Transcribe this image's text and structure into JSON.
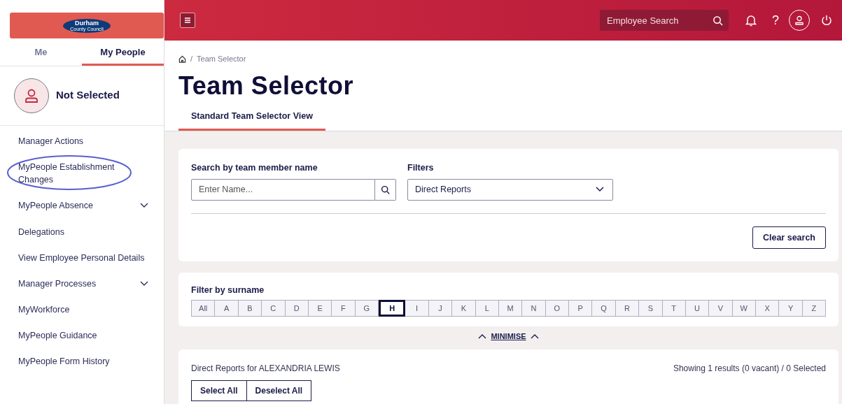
{
  "logo": {
    "name": "Durham",
    "subtitle": "County Council"
  },
  "sidebar_tabs": [
    {
      "label": "Me",
      "selected": false
    },
    {
      "label": "My People",
      "selected": true
    }
  ],
  "profile": {
    "name": "Not Selected"
  },
  "menu": [
    {
      "label": "Manager Actions",
      "expandable": false,
      "circled": false
    },
    {
      "label": "MyPeople Establishment Changes",
      "expandable": false,
      "circled": true
    },
    {
      "label": "MyPeople Absence",
      "expandable": true,
      "circled": false
    },
    {
      "label": "Delegations",
      "expandable": false,
      "circled": false
    },
    {
      "label": "View Employee Personal Details",
      "expandable": false,
      "circled": false
    },
    {
      "label": "Manager Processes",
      "expandable": true,
      "circled": false
    },
    {
      "label": "MyWorkforce",
      "expandable": false,
      "circled": false
    },
    {
      "label": "MyPeople Guidance",
      "expandable": false,
      "circled": false
    },
    {
      "label": "MyPeople Form History",
      "expandable": false,
      "circled": false
    }
  ],
  "topbar": {
    "search_placeholder": "Employee Search",
    "help": "?"
  },
  "breadcrumb": [
    {
      "separator": "/",
      "label": "Team Selector"
    }
  ],
  "page_title": "Team Selector",
  "view_tabs": [
    {
      "label": "Standard Team Selector View",
      "selected": true
    }
  ],
  "search": {
    "label": "Search by team member name",
    "placeholder": "Enter Name..."
  },
  "filters": {
    "label": "Filters",
    "value": "Direct Reports"
  },
  "clear_button": "Clear search",
  "surname_filter": {
    "label": "Filter by surname",
    "letters": [
      {
        "label": "All",
        "selected": false
      },
      {
        "label": "A",
        "selected": false
      },
      {
        "label": "B",
        "selected": false
      },
      {
        "label": "C",
        "selected": false
      },
      {
        "label": "D",
        "selected": false
      },
      {
        "label": "E",
        "selected": false
      },
      {
        "label": "F",
        "selected": false
      },
      {
        "label": "G",
        "selected": false
      },
      {
        "label": "H",
        "selected": true
      },
      {
        "label": "I",
        "selected": false
      },
      {
        "label": "J",
        "selected": false
      },
      {
        "label": "K",
        "selected": false
      },
      {
        "label": "L",
        "selected": false
      },
      {
        "label": "M",
        "selected": false
      },
      {
        "label": "N",
        "selected": false
      },
      {
        "label": "O",
        "selected": false
      },
      {
        "label": "P",
        "selected": false
      },
      {
        "label": "Q",
        "selected": false
      },
      {
        "label": "R",
        "selected": false
      },
      {
        "label": "S",
        "selected": false
      },
      {
        "label": "T",
        "selected": false
      },
      {
        "label": "U",
        "selected": false
      },
      {
        "label": "V",
        "selected": false
      },
      {
        "label": "W",
        "selected": false
      },
      {
        "label": "X",
        "selected": false
      },
      {
        "label": "Y",
        "selected": false
      },
      {
        "label": "Z",
        "selected": false
      }
    ]
  },
  "minimise": "MINIMISE",
  "results": {
    "title": "Direct Reports for ALEXANDRIA LEWIS",
    "summary": "Showing 1 results (0 vacant) / 0 Selected",
    "buttons": [
      "Select All",
      "Deselect All"
    ]
  }
}
